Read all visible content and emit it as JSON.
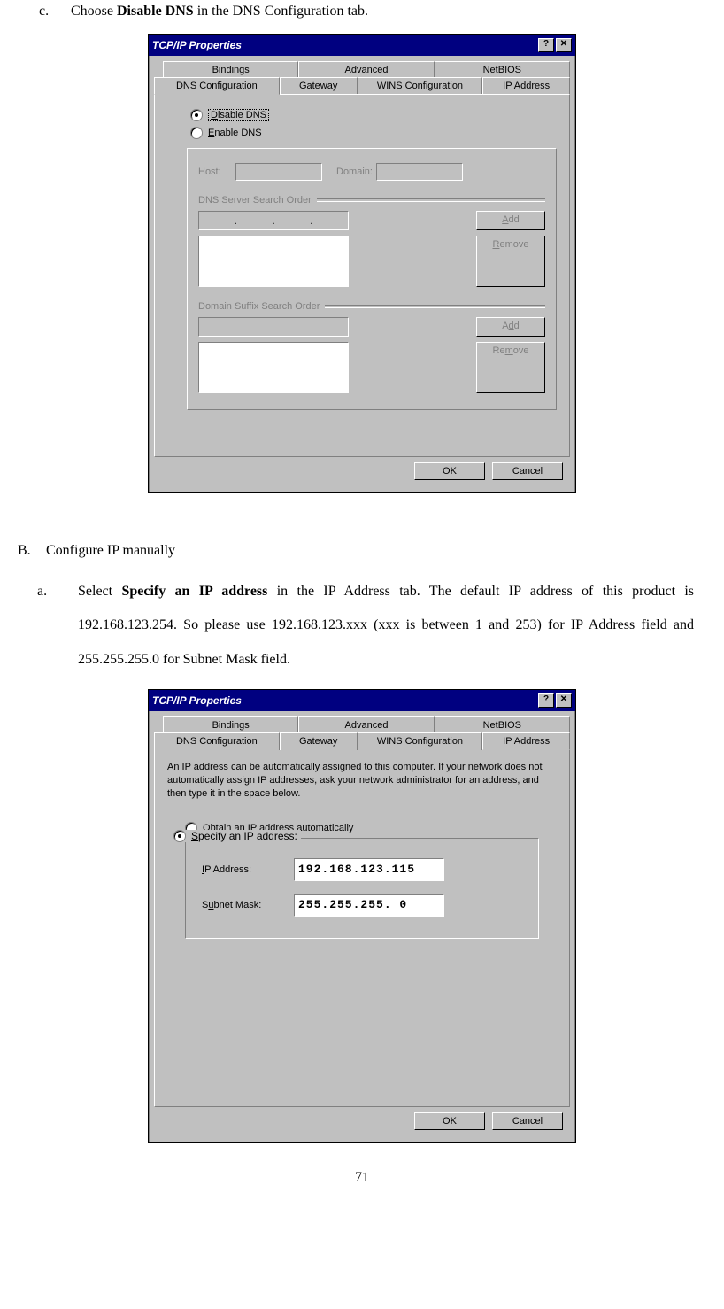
{
  "instructions": {
    "c_letter": "c.",
    "c_text_prefix": "Choose ",
    "c_bold": "Disable DNS",
    "c_text_suffix": " in the DNS Configuration tab.",
    "B_letter": "B.",
    "B_text": "Configure IP manually",
    "a_letter": "a.",
    "a_text_prefix": "Select ",
    "a_bold": "Specify an IP address",
    "a_text_suffix": " in the IP Address tab. The default IP address of this product is 192.168.123.254. So please use 192.168.123.xxx (xxx is between 1 and 253) for IP Address field and 255.255.255.0 for Subnet Mask field."
  },
  "dialog1": {
    "title": "TCP/IP Properties",
    "help_btn": "?",
    "close_btn": "✕",
    "tabs_back": [
      "Bindings",
      "Advanced",
      "NetBIOS"
    ],
    "tabs_front": [
      "DNS Configuration",
      "Gateway",
      "WINS Configuration",
      "IP Address"
    ],
    "active_tab": "DNS Configuration",
    "radio_disable": "Disable DNS",
    "radio_enable": "Enable DNS",
    "host_label": "Host:",
    "domain_label": "Domain:",
    "dns_order_label": "DNS Server Search Order",
    "add_btn": "Add",
    "remove_btn": "Remove",
    "suffix_order_label": "Domain Suffix Search Order",
    "ok_btn": "OK",
    "cancel_btn": "Cancel"
  },
  "dialog2": {
    "title": "TCP/IP Properties",
    "help_btn": "?",
    "close_btn": "✕",
    "tabs_back": [
      "Bindings",
      "Advanced",
      "NetBIOS"
    ],
    "tabs_front": [
      "DNS Configuration",
      "Gateway",
      "WINS Configuration",
      "IP Address"
    ],
    "active_tab": "IP Address",
    "intro": "An IP address can be automatically assigned to this computer. If your network does not automatically assign IP addresses, ask your network administrator for an address, and then type it in the space below.",
    "radio_obtain": "Obtain an IP address automatically",
    "radio_specify": "Specify an IP address:",
    "ip_label": "IP Address:",
    "ip_value": "192.168.123.115",
    "subnet_label": "Subnet Mask:",
    "subnet_value": "255.255.255.  0",
    "ok_btn": "OK",
    "cancel_btn": "Cancel"
  },
  "page_number": "71"
}
